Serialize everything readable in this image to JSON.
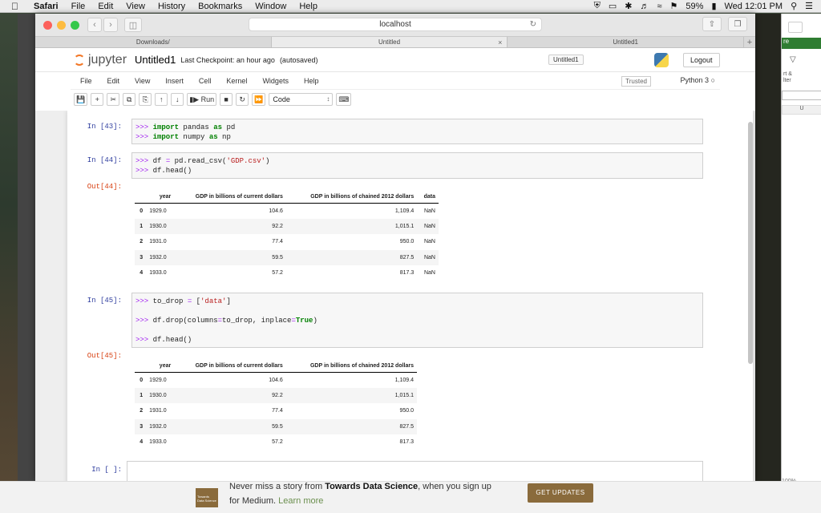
{
  "menubar": {
    "app": "Safari",
    "items": [
      "File",
      "Edit",
      "View",
      "History",
      "Bookmarks",
      "Window",
      "Help"
    ],
    "battery": "59%",
    "clock": "Wed 12:01 PM"
  },
  "browser": {
    "url": "localhost",
    "tabs": [
      {
        "label": "Downloads/",
        "active": false
      },
      {
        "label": "Untitled",
        "active": true
      },
      {
        "label": "Untitled1",
        "active": false
      }
    ]
  },
  "jupyter": {
    "logo_text": "jupyter",
    "notebook_name": "Untitled1",
    "checkpoint": "Last Checkpoint: an hour ago",
    "autosave": "(autosaved)",
    "kernel_tab": "Untitled1",
    "logout": "Logout",
    "menu": [
      "File",
      "Edit",
      "View",
      "Insert",
      "Cell",
      "Kernel",
      "Widgets",
      "Help"
    ],
    "trusted": "Trusted",
    "kernel": "Python 3",
    "run_label": "Run",
    "cell_type": "Code"
  },
  "cells": {
    "c43": {
      "prompt": "In [43]:"
    },
    "c44": {
      "prompt": "In [44]:",
      "out": "Out[44]:"
    },
    "c45": {
      "prompt": "In [45]:",
      "out": "Out[45]:"
    },
    "cempty": {
      "prompt": "In [ ]:"
    }
  },
  "table1": {
    "headers": [
      "",
      "year",
      "GDP in billions of current dollars",
      "GDP in billions of chained 2012 dollars",
      "data"
    ],
    "rows": [
      [
        "0",
        "1929.0",
        "104.6",
        "1,109.4",
        "NaN"
      ],
      [
        "1",
        "1930.0",
        "92.2",
        "1,015.1",
        "NaN"
      ],
      [
        "2",
        "1931.0",
        "77.4",
        "950.0",
        "NaN"
      ],
      [
        "3",
        "1932.0",
        "59.5",
        "827.5",
        "NaN"
      ],
      [
        "4",
        "1933.0",
        "57.2",
        "817.3",
        "NaN"
      ]
    ]
  },
  "table2": {
    "headers": [
      "",
      "year",
      "GDP in billions of current dollars",
      "GDP in billions of chained 2012 dollars"
    ],
    "rows": [
      [
        "0",
        "1929.0",
        "104.6",
        "1,109.4"
      ],
      [
        "1",
        "1930.0",
        "92.2",
        "1,015.1"
      ],
      [
        "2",
        "1931.0",
        "77.4",
        "950.0"
      ],
      [
        "3",
        "1932.0",
        "59.5",
        "827.5"
      ],
      [
        "4",
        "1933.0",
        "57.2",
        "817.3"
      ]
    ]
  },
  "side": {
    "t1": "rt &",
    "t2": "lter",
    "t3": "U",
    "zoom": "100%",
    "bar": "re"
  },
  "banner": {
    "logo": "Towards Data Science",
    "pre": "Never miss a story from ",
    "pub": "Towards Data Science",
    "post": ", when you sign up",
    "line2": "for Medium.",
    "learn": "Learn more",
    "button": "GET UPDATES"
  },
  "colors": {
    "jupyter_orange": "#f37726",
    "prompt_in": "#303f9f",
    "prompt_out": "#d84315",
    "banner_brown": "#8a6b3c"
  }
}
